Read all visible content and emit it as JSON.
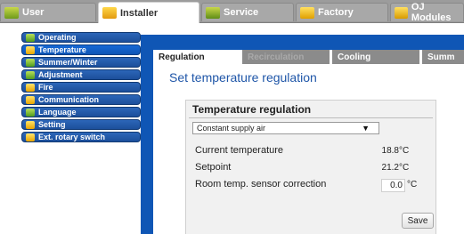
{
  "top_tabs": [
    {
      "label": "User",
      "icon": "user-icon"
    },
    {
      "label": "Installer",
      "icon": "installer-icon"
    },
    {
      "label": "Service",
      "icon": "service-icon"
    },
    {
      "label": "Factory",
      "icon": "factory-icon"
    },
    {
      "label": "OJ Modules",
      "icon": "oj-modules-icon"
    }
  ],
  "active_top_tab": "Installer",
  "sidebar": {
    "items": [
      {
        "label": "Operating",
        "icon": "operating-icon"
      },
      {
        "label": "Temperature",
        "icon": "temperature-icon"
      },
      {
        "label": "Summer/Winter",
        "icon": "summer-winter-icon"
      },
      {
        "label": "Adjustment",
        "icon": "adjustment-icon"
      },
      {
        "label": "Fire",
        "icon": "fire-icon"
      },
      {
        "label": "Communication",
        "icon": "communication-icon"
      },
      {
        "label": "Language",
        "icon": "language-icon"
      },
      {
        "label": "Setting",
        "icon": "setting-icon"
      },
      {
        "label": "Ext. rotary switch",
        "icon": "rotary-switch-icon"
      }
    ],
    "active": "Temperature"
  },
  "sub_tabs": [
    {
      "label": "Regulation"
    },
    {
      "label": "Recirculation"
    },
    {
      "label": "Cooling"
    },
    {
      "label": "Summ"
    }
  ],
  "main": {
    "heading": "Set temperature regulation",
    "panel": {
      "title": "Temperature regulation",
      "mode_select": {
        "value": "Constant supply air"
      },
      "rows": [
        {
          "label": "Current temperature",
          "value": "18.8",
          "unit": "°C"
        },
        {
          "label": "Setpoint",
          "value": "21.2",
          "unit": "°C"
        },
        {
          "label": "Room temp. sensor correction",
          "value": "0.0",
          "unit": "°C"
        }
      ],
      "save_label": "Save"
    }
  },
  "colors": {
    "sidebar_blue": "#1c4f9b",
    "main_blue": "#0f56b5",
    "heading_blue": "#1f56a8",
    "tab_gray": "#8b8b8b"
  }
}
